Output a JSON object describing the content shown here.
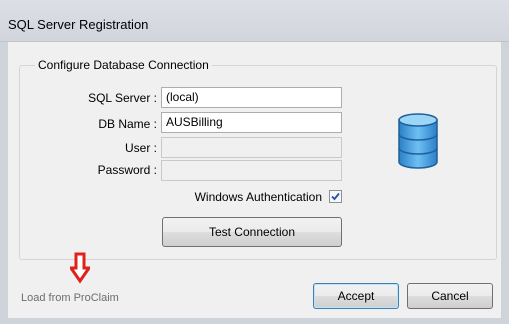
{
  "window": {
    "title": "SQL Server Registration"
  },
  "group": {
    "title": "Configure Database Connection"
  },
  "form": {
    "sql_server_label": "SQL Server :",
    "sql_server_value": "(local)",
    "db_name_label": "DB Name :",
    "db_name_value": "AUSBilling",
    "user_label": "User :",
    "user_value": "",
    "password_label": "Password :",
    "password_value": ""
  },
  "windows_auth": {
    "label": "Windows Authentication",
    "checked": true
  },
  "buttons": {
    "test_connection": "Test Connection",
    "accept": "Accept",
    "cancel": "Cancel"
  },
  "footer": {
    "load_label": "Load from ProClaim"
  },
  "icons": {
    "database": "database-icon",
    "annotation_arrow": "down-arrow-icon"
  },
  "colors": {
    "database_icon": "#4aa8e8",
    "annotation_arrow": "#e0201b"
  }
}
